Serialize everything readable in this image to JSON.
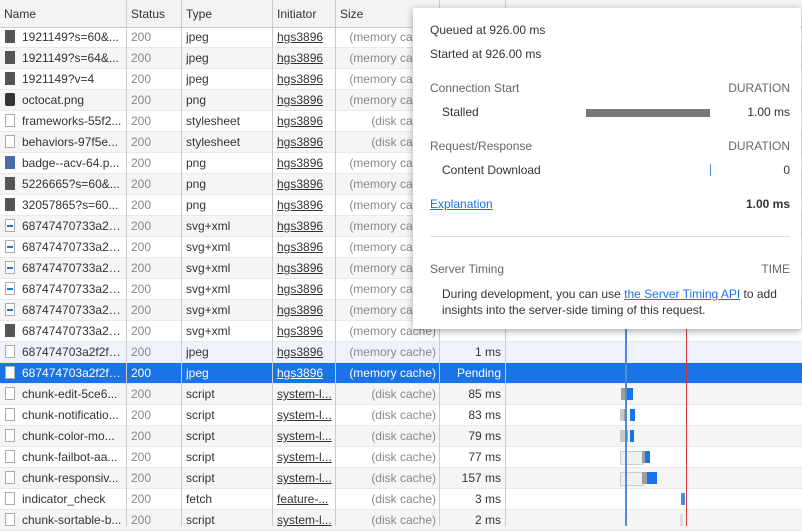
{
  "columns": {
    "name": "Name",
    "status": "Status",
    "type": "Type",
    "initiator": "Initiator",
    "size": "Size"
  },
  "rows": [
    {
      "name": "1921149?s=60&...",
      "status": "200",
      "type": "jpeg",
      "initiator": "hgs3896",
      "size": "(memory cache)",
      "time": "",
      "icon": "img"
    },
    {
      "name": "1921149?s=64&...",
      "status": "200",
      "type": "jpeg",
      "initiator": "hgs3896",
      "size": "(memory cache)",
      "time": "",
      "icon": "img"
    },
    {
      "name": "1921149?v=4",
      "status": "200",
      "type": "jpeg",
      "initiator": "hgs3896",
      "size": "(memory cache)",
      "time": "",
      "icon": "img"
    },
    {
      "name": "octocat.png",
      "status": "200",
      "type": "png",
      "initiator": "hgs3896",
      "size": "(memory cache)",
      "time": "",
      "icon": "octo"
    },
    {
      "name": "frameworks-55f2...",
      "status": "200",
      "type": "stylesheet",
      "initiator": "hgs3896",
      "size": "(disk cache)",
      "time": "",
      "icon": "file"
    },
    {
      "name": "behaviors-97f5e...",
      "status": "200",
      "type": "stylesheet",
      "initiator": "hgs3896",
      "size": "(disk cache)",
      "time": "",
      "icon": "file"
    },
    {
      "name": "badge--acv-64.p...",
      "status": "200",
      "type": "png",
      "initiator": "hgs3896",
      "size": "(memory cache)",
      "time": "",
      "icon": "png"
    },
    {
      "name": "5226665?s=60&...",
      "status": "200",
      "type": "png",
      "initiator": "hgs3896",
      "size": "(memory cache)",
      "time": "",
      "icon": "img"
    },
    {
      "name": "32057865?s=60...",
      "status": "200",
      "type": "png",
      "initiator": "hgs3896",
      "size": "(memory cache)",
      "time": "",
      "icon": "img"
    },
    {
      "name": "68747470733a2f...",
      "status": "200",
      "type": "svg+xml",
      "initiator": "hgs3896",
      "size": "(memory cache)",
      "time": "",
      "icon": "svg"
    },
    {
      "name": "68747470733a2f...",
      "status": "200",
      "type": "svg+xml",
      "initiator": "hgs3896",
      "size": "(memory cache)",
      "time": "",
      "icon": "svg"
    },
    {
      "name": "68747470733a2f...",
      "status": "200",
      "type": "svg+xml",
      "initiator": "hgs3896",
      "size": "(memory cache)",
      "time": "",
      "icon": "svg"
    },
    {
      "name": "68747470733a2f...",
      "status": "200",
      "type": "svg+xml",
      "initiator": "hgs3896",
      "size": "(memory cache)",
      "time": "",
      "icon": "svg"
    },
    {
      "name": "68747470733a2f...",
      "status": "200",
      "type": "svg+xml",
      "initiator": "hgs3896",
      "size": "(memory cache)",
      "time": "",
      "icon": "svg"
    },
    {
      "name": "68747470733a2f...",
      "status": "200",
      "type": "svg+xml",
      "initiator": "hgs3896",
      "size": "(memory cache)",
      "time": "",
      "icon": "img"
    },
    {
      "name": "687474703a2f2f7...",
      "status": "200",
      "type": "jpeg",
      "initiator": "hgs3896",
      "size": "(memory cache)",
      "time": "1 ms",
      "icon": "file"
    },
    {
      "name": "687474703a2f2f7...",
      "status": "200",
      "type": "jpeg",
      "initiator": "hgs3896",
      "size": "(memory cache)",
      "time": "Pending",
      "icon": "file",
      "selected": true
    },
    {
      "name": "chunk-edit-5ce6...",
      "status": "200",
      "type": "script",
      "initiator": "system-l...",
      "size": "(disk cache)",
      "time": "85 ms",
      "icon": "file"
    },
    {
      "name": "chunk-notificatio...",
      "status": "200",
      "type": "script",
      "initiator": "system-l...",
      "size": "(disk cache)",
      "time": "83 ms",
      "icon": "file"
    },
    {
      "name": "chunk-color-mo...",
      "status": "200",
      "type": "script",
      "initiator": "system-l...",
      "size": "(disk cache)",
      "time": "79 ms",
      "icon": "file"
    },
    {
      "name": "chunk-failbot-aa...",
      "status": "200",
      "type": "script",
      "initiator": "system-l...",
      "size": "(disk cache)",
      "time": "77 ms",
      "icon": "file"
    },
    {
      "name": "chunk-responsiv...",
      "status": "200",
      "type": "script",
      "initiator": "system-l...",
      "size": "(disk cache)",
      "time": "157 ms",
      "icon": "file"
    },
    {
      "name": "indicator_check",
      "status": "200",
      "type": "fetch",
      "initiator": "feature-...",
      "size": "(disk cache)",
      "time": "3 ms",
      "icon": "file"
    },
    {
      "name": "chunk-sortable-b...",
      "status": "200",
      "type": "script",
      "initiator": "system-l...",
      "size": "(disk cache)",
      "time": "2 ms",
      "icon": "file"
    }
  ],
  "tooltip": {
    "queued": "Queued at 926.00 ms",
    "started": "Started at 926.00 ms",
    "connection_start": "Connection Start",
    "duration1": "DURATION",
    "stalled_label": "Stalled",
    "stalled_value": "1.00 ms",
    "request_response": "Request/Response",
    "duration2": "DURATION",
    "content_download": "Content Download",
    "content_download_value": "0",
    "explanation": "Explanation",
    "total": "1.00 ms",
    "server_timing": "Server Timing",
    "time_label": "TIME",
    "dev_text_1": "During development, you can use",
    "dev_link": "the Server Timing API",
    "dev_text_2": "to add",
    "dev_text_3": "insights into the server-side timing of this request."
  }
}
